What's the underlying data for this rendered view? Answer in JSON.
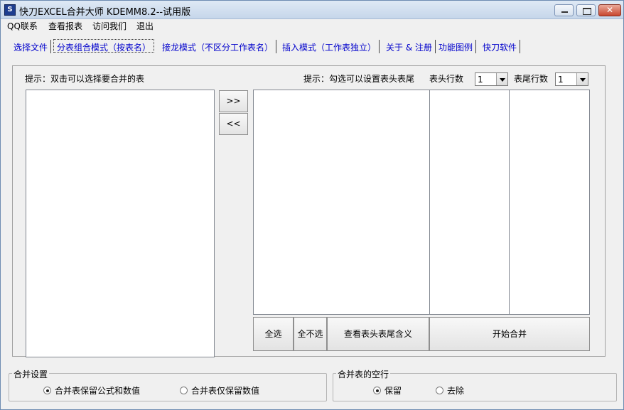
{
  "window": {
    "title": "快刀EXCEL合并大师 KDEMM8.2--试用版",
    "icon_label": "S",
    "close_glyph": "✕"
  },
  "menu": [
    "QQ联系",
    "查看报表",
    "访问我们",
    "退出"
  ],
  "tabs": [
    "选择文件",
    "分表组合模式（按表名）",
    "接龙模式（不区分工作表名）",
    "插入模式（工作表独立）",
    "关于 & 注册",
    "功能图例",
    "快刀软件"
  ],
  "main": {
    "hint_left": "提示：双击可以选择要合并的表",
    "hint_right": "提示：勾选可以设置表头表尾",
    "header_rows_label": "表头行数",
    "header_rows_value": "1",
    "footer_rows_label": "表尾行数",
    "footer_rows_value": "1",
    "move_right_label": ">>",
    "move_left_label": "<<",
    "select_all_label": "全选",
    "select_none_label": "全不选",
    "view_meaning_label": "查看表头表尾含义",
    "start_merge_label": "开始合并"
  },
  "merge_settings": {
    "title": "合并设置",
    "options": [
      "合并表保留公式和数值",
      "合并表仅保留数值"
    ],
    "selected": 0
  },
  "blank_rows": {
    "title": "合并表的空行",
    "options": [
      "保留",
      "去除"
    ],
    "selected": 0
  }
}
